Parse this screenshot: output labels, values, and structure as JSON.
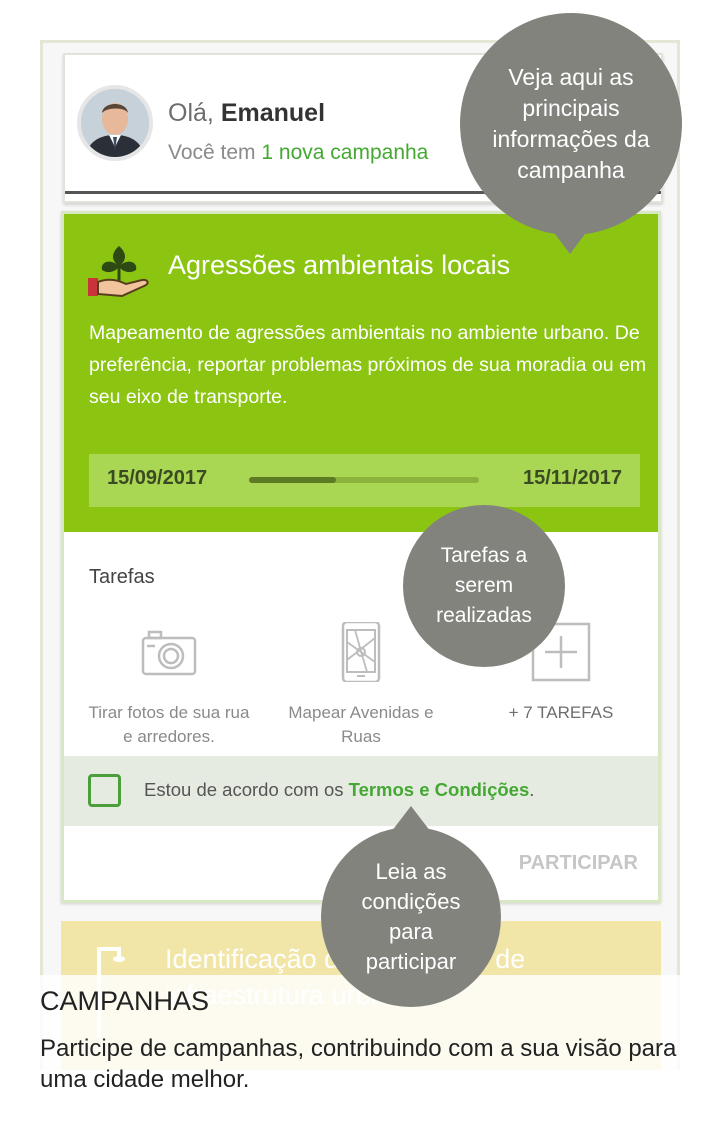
{
  "header": {
    "greeting_prefix": "Olá,",
    "user_name": "Emanuel",
    "subtitle_prefix": "Você tem",
    "subtitle_link": "1 nova campanha"
  },
  "campaign": {
    "title": "Agressões ambientais locais",
    "description": "Mapeamento de agressões ambientais no ambiente urbano. De preferência, reportar problemas próximos de sua moradia ou em seu eixo de transporte.",
    "start_date": "15/09/2017",
    "end_date": "15/11/2017",
    "progress": 0.38,
    "icon": "plant-in-hand-icon",
    "tasks_title": "Tarefas",
    "tasks": [
      {
        "label": "Tirar fotos de sua rua e arredores.",
        "icon": "camera-icon"
      },
      {
        "label": "Mapear Avenidas e Ruas",
        "icon": "phone-map-icon"
      },
      {
        "label": "+ 7 TAREFAS",
        "icon": "plus-icon"
      }
    ],
    "agree_prefix": "Estou de acordo com os",
    "agree_link": "Termos e Condições",
    "agree_suffix": ".",
    "participate_label": "PARTICIPAR"
  },
  "next_campaign": {
    "title": "Identificação de problemas de infraestrutura urbana",
    "icon": "street-lamp-icon"
  },
  "tooltips": {
    "info": "Veja aqui as principais informações da campanha",
    "tasks": "Tarefas a serem realizadas",
    "terms": "Leia as condições para participar"
  },
  "footer": {
    "section_title": "CAMPANHAS",
    "section_description": "Participe de campanhas, contribuindo com a sua visão para uma cidade melhor."
  },
  "colors": {
    "campaign_green": "#8bc511",
    "link_green": "#44a832",
    "tooltip_gray": "#82837d",
    "next_card_yellow": "#f1e6a8"
  }
}
